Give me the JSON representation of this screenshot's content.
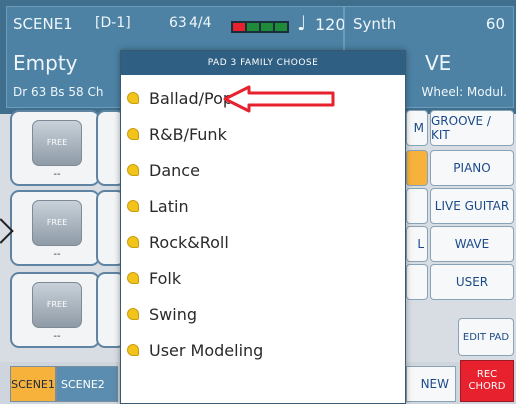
{
  "header": {
    "scene_name": "SCENE1",
    "variation": "[D-1]",
    "tempo_number": "63",
    "time_signature": "4/4",
    "bpm": "120",
    "song_name": "Empty",
    "bottom_row": "Dr 63  Bs 58  Ch",
    "right_label": "Synth",
    "right_number": "60",
    "right_title": "VE",
    "wheel_label": "Wheel: Modul.",
    "tempo_bar_colors": [
      "#e7212d",
      "#1e8a3a",
      "#1e8a3a",
      "#1e8a3a"
    ]
  },
  "dialog": {
    "title": "PAD 3 FAMILY CHOOSE",
    "items": [
      {
        "label": "Ballad/Pop",
        "selected": true
      },
      {
        "label": "R&B/Funk"
      },
      {
        "label": "Dance"
      },
      {
        "label": "Latin"
      },
      {
        "label": "Rock&Roll"
      },
      {
        "label": "Folk"
      },
      {
        "label": "Swing"
      },
      {
        "label": "User Modeling"
      }
    ]
  },
  "pads": {
    "label": "FREE",
    "dash": "--"
  },
  "right_buttons": [
    {
      "label": "GROOVE / KIT"
    },
    {
      "label": "PIANO"
    },
    {
      "label": "LIVE GUITAR"
    },
    {
      "label": "WAVE"
    },
    {
      "label": "USER"
    }
  ],
  "mid_buttons": [
    {
      "label": "M"
    },
    {
      "label": ""
    },
    {
      "label": ""
    },
    {
      "label": "L"
    },
    {
      "label": ""
    }
  ],
  "edit_pad": {
    "label": "EDIT PAD"
  },
  "bottom": {
    "scene1": "SCENE1",
    "scene2": "SCENE2",
    "new": "NEW",
    "rec": "REC",
    "chord": "CHORD"
  },
  "colors": {
    "accent": "#f7b23c",
    "dialog_header": "#2f5f82",
    "rec": "#e7212d",
    "callout_arrow": "#e7212d"
  }
}
